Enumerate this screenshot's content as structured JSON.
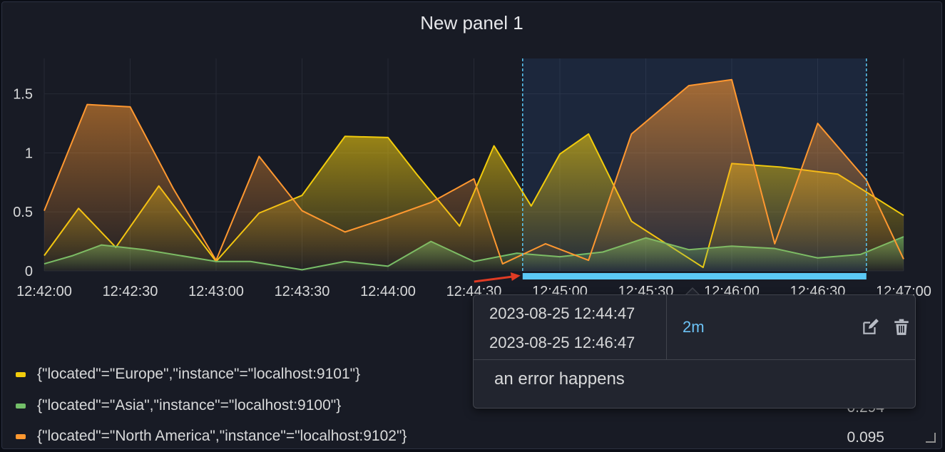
{
  "panel": {
    "title": "New panel 1"
  },
  "chart_data": {
    "type": "area",
    "x_ticks": [
      "12:42:00",
      "12:42:30",
      "12:43:00",
      "12:43:30",
      "12:44:00",
      "12:44:30",
      "12:45:00",
      "12:45:30",
      "12:46:00",
      "12:46:30",
      "12:47:00"
    ],
    "y_ticks": [
      "0",
      "0.5",
      "1",
      "1.5"
    ],
    "ylim": [
      0,
      1.8
    ],
    "x_range": [
      "12:42:00",
      "12:47:00"
    ],
    "grid": true,
    "legend_position": "bottom",
    "series": [
      {
        "name": "{\"located\"=\"Europe\",\"instance\"=\"localhost:9101\"}",
        "color": "#f2cc0c",
        "points": [
          [
            "12:42:00",
            0.13
          ],
          [
            "12:42:12",
            0.53
          ],
          [
            "12:42:25",
            0.2
          ],
          [
            "12:42:40",
            0.72
          ],
          [
            "12:43:00",
            0.08
          ],
          [
            "12:43:15",
            0.49
          ],
          [
            "12:43:30",
            0.64
          ],
          [
            "12:43:45",
            1.14
          ],
          [
            "12:44:00",
            1.13
          ],
          [
            "12:44:10",
            0.82
          ],
          [
            "12:44:25",
            0.38
          ],
          [
            "12:44:37",
            1.06
          ],
          [
            "12:44:50",
            0.55
          ],
          [
            "12:45:00",
            0.99
          ],
          [
            "12:45:10",
            1.16
          ],
          [
            "12:45:25",
            0.42
          ],
          [
            "12:45:50",
            0.03
          ],
          [
            "12:46:00",
            0.91
          ],
          [
            "12:46:17",
            0.88
          ],
          [
            "12:46:37",
            0.82
          ],
          [
            "12:47:00",
            0.47
          ]
        ]
      },
      {
        "name": "{\"located\"=\"Asia\",\"instance\"=\"localhost:9100\"}",
        "color": "#73bf69",
        "points": [
          [
            "12:42:00",
            0.06
          ],
          [
            "12:42:10",
            0.13
          ],
          [
            "12:42:20",
            0.22
          ],
          [
            "12:42:35",
            0.18
          ],
          [
            "12:43:00",
            0.08
          ],
          [
            "12:43:12",
            0.08
          ],
          [
            "12:43:30",
            0.01
          ],
          [
            "12:43:45",
            0.08
          ],
          [
            "12:44:00",
            0.04
          ],
          [
            "12:44:15",
            0.25
          ],
          [
            "12:44:30",
            0.08
          ],
          [
            "12:44:45",
            0.15
          ],
          [
            "12:45:00",
            0.12
          ],
          [
            "12:45:15",
            0.16
          ],
          [
            "12:45:30",
            0.28
          ],
          [
            "12:45:45",
            0.18
          ],
          [
            "12:46:00",
            0.21
          ],
          [
            "12:46:15",
            0.19
          ],
          [
            "12:46:30",
            0.11
          ],
          [
            "12:46:45",
            0.14
          ],
          [
            "12:47:00",
            0.29
          ]
        ]
      },
      {
        "name": "{\"located\"=\"North America\",\"instance\"=\"localhost:9102\"}",
        "color": "#ff9830",
        "points": [
          [
            "12:42:00",
            0.51
          ],
          [
            "12:42:15",
            1.41
          ],
          [
            "12:42:30",
            1.39
          ],
          [
            "12:42:45",
            0.7
          ],
          [
            "12:43:00",
            0.09
          ],
          [
            "12:43:15",
            0.97
          ],
          [
            "12:43:30",
            0.51
          ],
          [
            "12:43:45",
            0.33
          ],
          [
            "12:44:00",
            0.45
          ],
          [
            "12:44:15",
            0.58
          ],
          [
            "12:44:30",
            0.78
          ],
          [
            "12:44:40",
            0.06
          ],
          [
            "12:44:55",
            0.23
          ],
          [
            "12:45:10",
            0.09
          ],
          [
            "12:45:25",
            1.16
          ],
          [
            "12:45:45",
            1.57
          ],
          [
            "12:46:00",
            1.62
          ],
          [
            "12:46:15",
            0.23
          ],
          [
            "12:46:30",
            1.25
          ],
          [
            "12:46:47",
            0.77
          ],
          [
            "12:47:00",
            0.1
          ]
        ]
      }
    ],
    "annotation": {
      "time_start": "2023-08-25 12:44:47",
      "time_end": "2023-08-25 12:46:47",
      "duration": "2m",
      "text": "an error happens",
      "region_color": "#5bc8f5"
    }
  },
  "legend": {
    "items": [
      {
        "label": "{\"located\"=\"Europe\",\"instance\"=\"localhost:9101\"}",
        "color": "#f2cc0c",
        "value": ""
      },
      {
        "label": "{\"located\"=\"Asia\",\"instance\"=\"localhost:9100\"}",
        "color": "#73bf69",
        "value": "0.294"
      },
      {
        "label": "{\"located\"=\"North America\",\"instance\"=\"localhost:9102\"}",
        "color": "#ff9830",
        "value": "0.095"
      }
    ]
  },
  "tooltip": {
    "time_start": "2023-08-25 12:44:47",
    "time_end": "2023-08-25 12:46:47",
    "duration": "2m",
    "text": "an error happens",
    "edit_icon": "edit-icon",
    "delete_icon": "trash-icon"
  }
}
